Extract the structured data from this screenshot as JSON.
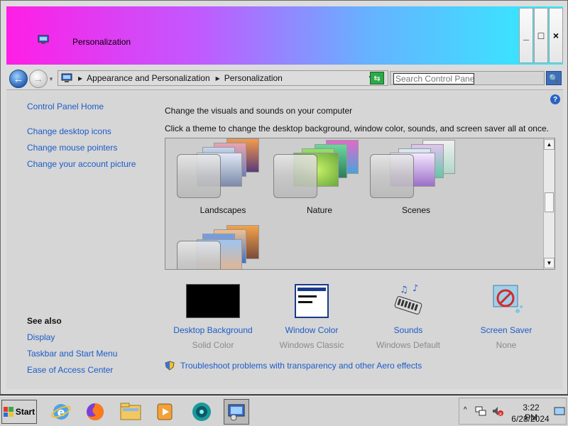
{
  "window": {
    "title": "Personalization",
    "controls": {
      "minimize": "_",
      "maximize": "□",
      "close": "×"
    }
  },
  "address": {
    "back_icon": "back-arrow-icon",
    "forward_icon": "forward-arrow-icon",
    "breadcrumbs": [
      "Appearance and Personalization",
      "Personalization"
    ],
    "search_placeholder": "Search Control Panel"
  },
  "sidebar": {
    "home_link": "Control Panel Home",
    "tasks": [
      "Change desktop icons",
      "Change mouse pointers",
      "Change your account picture"
    ],
    "see_also_title": "See also",
    "see_also": [
      "Display",
      "Taskbar and Start Menu",
      "Ease of Access Center"
    ]
  },
  "main": {
    "heading": "Change the visuals and sounds on your computer",
    "subheading": "Click a theme to change the desktop background, window color, sounds, and screen saver all at once.",
    "themes": [
      "Landscapes",
      "Nature",
      "Scenes",
      ""
    ],
    "options": [
      {
        "title": "Desktop Background",
        "sub": "Solid Color",
        "icon": "desktop-background-icon"
      },
      {
        "title": "Window Color",
        "sub": "Windows Classic",
        "icon": "window-color-icon"
      },
      {
        "title": "Sounds",
        "sub": "Windows Default",
        "icon": "sounds-icon"
      },
      {
        "title": "Screen Saver",
        "sub": "None",
        "icon": "screen-saver-icon"
      }
    ],
    "troubleshoot_link": "Troubleshoot problems with transparency and other Aero effects"
  },
  "taskbar": {
    "start_label": "Start",
    "apps": [
      "internet-explorer-icon",
      "firefox-icon",
      "file-explorer-icon",
      "media-player-icon",
      "media-center-icon",
      "control-panel-icon"
    ],
    "time": "3:22 PM",
    "date": "6/28/2024"
  },
  "colors": {
    "link": "#1c5cc9",
    "title_gradient": [
      "#ff1ee6",
      "#2ff0ff"
    ]
  }
}
